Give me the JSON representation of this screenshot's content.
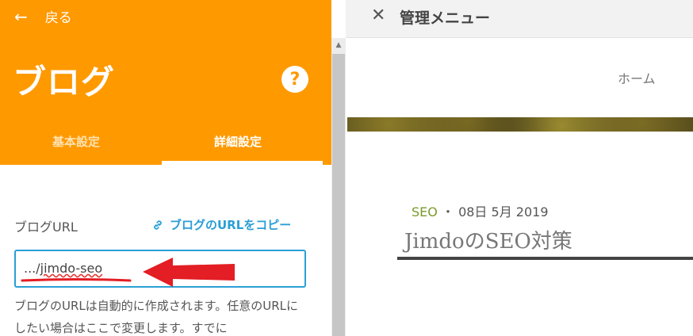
{
  "sidebar": {
    "back_label": "戻る",
    "title": "ブログ",
    "help_label": "?",
    "tabs": [
      {
        "label": "基本設定",
        "active": false
      },
      {
        "label": "詳細設定",
        "active": true
      }
    ],
    "url_field": {
      "label": "ブログURL",
      "copy_label": "ブログのURLをコピー",
      "prefix": ".../",
      "value": "jimdo-seo"
    },
    "help_text": "ブログのURLは自動的に作成されます。任意のURLにしたい場合はここで変更します。すでに"
  },
  "admin_bar": {
    "title": "管理メニュー"
  },
  "site": {
    "nav_home": "ホーム",
    "post": {
      "category": "SEO",
      "separator": "・",
      "date": "08日 5月 2019",
      "title": "JimdoのSEO対策"
    }
  },
  "colors": {
    "header_orange": "#FF9900",
    "link_blue": "#2A9FD6",
    "annotation_red": "#E31E24",
    "category_green": "#7A9A2A"
  },
  "icons": [
    "back-arrow-icon",
    "help-icon",
    "link-icon",
    "close-icon",
    "scroll-up-icon"
  ]
}
